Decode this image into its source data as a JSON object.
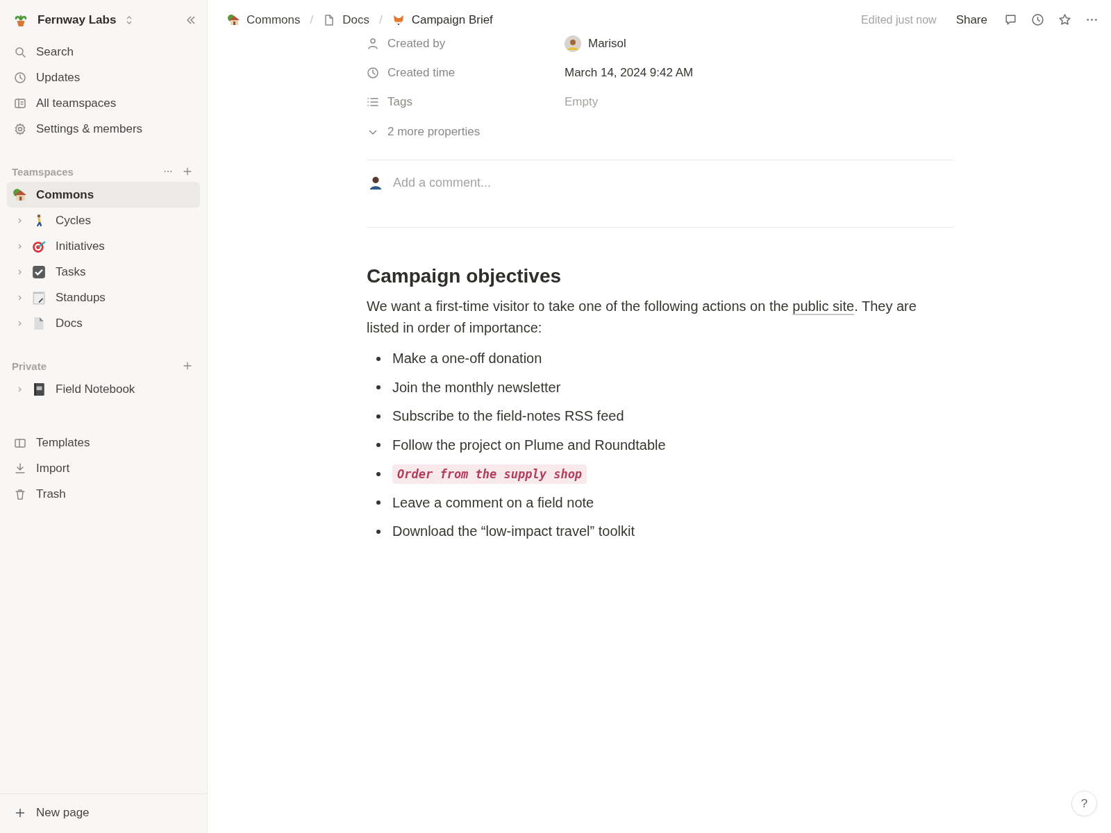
{
  "workspace": {
    "name": "Fernway Labs"
  },
  "nav": [
    {
      "label": "Search",
      "kind": "search"
    },
    {
      "label": "Updates",
      "kind": "clock"
    },
    {
      "label": "All teamspaces",
      "kind": "panel"
    },
    {
      "label": "Settings & members",
      "kind": "gear"
    }
  ],
  "teamspaces": {
    "title": "Teamspaces",
    "items": [
      {
        "label": "Commons",
        "kind": "house",
        "selected": true,
        "expandable": false
      },
      {
        "label": "Cycles",
        "kind": "walker",
        "selected": false,
        "expandable": true
      },
      {
        "label": "Initiatives",
        "kind": "target",
        "selected": false,
        "expandable": true
      },
      {
        "label": "Tasks",
        "kind": "check",
        "selected": false,
        "expandable": true
      },
      {
        "label": "Standups",
        "kind": "notepad",
        "selected": false,
        "expandable": true
      },
      {
        "label": "Docs",
        "kind": "page",
        "selected": false,
        "expandable": true
      }
    ]
  },
  "private": {
    "title": "Private",
    "items": [
      {
        "label": "Field Notebook",
        "kind": "notebook",
        "selected": false,
        "expandable": true
      }
    ]
  },
  "footer_nav": [
    {
      "label": "Templates",
      "kind": "book"
    },
    {
      "label": "Import",
      "kind": "download"
    },
    {
      "label": "Trash",
      "kind": "trash"
    }
  ],
  "new_page": "New page",
  "breadcrumb_separator": "/",
  "breadcrumbs": [
    {
      "label": "Commons",
      "kind": "house"
    },
    {
      "label": "Docs",
      "kind": "doc"
    },
    {
      "label": "Campaign Brief",
      "kind": "fox"
    }
  ],
  "topbar": {
    "status": "Edited just now",
    "share": "Share"
  },
  "properties": [
    {
      "name": "Created by",
      "kind": "person",
      "value": "Marisol",
      "avatar": true,
      "empty": false
    },
    {
      "name": "Created time",
      "kind": "clock",
      "value": "March 14, 2024 9:42 AM",
      "avatar": false,
      "empty": false
    },
    {
      "name": "Tags",
      "kind": "list",
      "value": "Empty",
      "avatar": false,
      "empty": true
    }
  ],
  "more_properties": "2 more properties",
  "comment": {
    "placeholder": "Add a comment..."
  },
  "heading": "Campaign objectives",
  "intro": {
    "before": "We want a first-time visitor to take one of the following actions on the ",
    "link": "public site",
    "after": ". They are listed in order of importance:"
  },
  "bullets": [
    {
      "text": "Make a one-off donation",
      "kind": "plain"
    },
    {
      "text": "Join the monthly newsletter",
      "kind": "plain"
    },
    {
      "text": "Subscribe to the field-notes RSS feed",
      "kind": "plain"
    },
    {
      "text": "Follow the project on Plume and Roundtable",
      "kind": "plain"
    },
    {
      "text": "Order from the supply shop",
      "kind": "code"
    },
    {
      "text": "Leave a comment on a field note",
      "kind": "plain"
    },
    {
      "text": "Download the “low-impact travel” toolkit",
      "kind": "plain"
    }
  ],
  "help": "?"
}
